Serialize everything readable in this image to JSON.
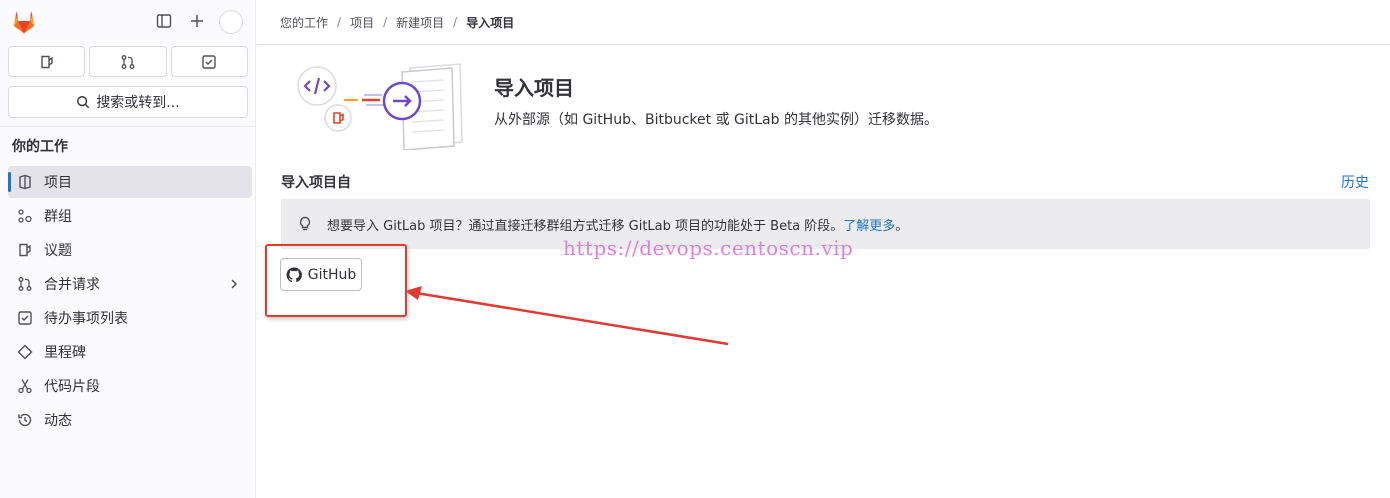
{
  "sidebar": {
    "search_label": "搜索或转到...",
    "section_title": "你的工作",
    "items": [
      {
        "label": "项目",
        "icon": "project-icon",
        "active": true
      },
      {
        "label": "群组",
        "icon": "group-icon"
      },
      {
        "label": "议题",
        "icon": "issues-icon"
      },
      {
        "label": "合并请求",
        "icon": "merge-request-icon",
        "has_submenu": true
      },
      {
        "label": "待办事项列表",
        "icon": "todo-icon"
      },
      {
        "label": "里程碑",
        "icon": "milestone-icon"
      },
      {
        "label": "代码片段",
        "icon": "snippet-icon"
      },
      {
        "label": "动态",
        "icon": "history-icon"
      }
    ]
  },
  "breadcrumb": [
    "您的工作",
    "项目",
    "新建项目",
    "导入项目"
  ],
  "header": {
    "title": "导入项目",
    "description": "从外部源（如 GitHub、Bitbucket 或 GitLab 的其他实例）迁移数据。"
  },
  "import_section": {
    "title": "导入项目自",
    "history_link": "历史"
  },
  "alert": {
    "text": "想要导入 GitLab 项目？通过直接迁移群组方式迁移 GitLab 项目的功能处于 Beta 阶段。",
    "link": "了解更多",
    "suffix": "。"
  },
  "sources": [
    {
      "label": "GitHub",
      "icon": "github-icon"
    }
  ],
  "watermark": "https://devops.centoscn.vip",
  "colors": {
    "accent": "#1f75cb",
    "annotation": "#e23a33",
    "watermark": "#e27ce7",
    "brand": "#e24329"
  }
}
